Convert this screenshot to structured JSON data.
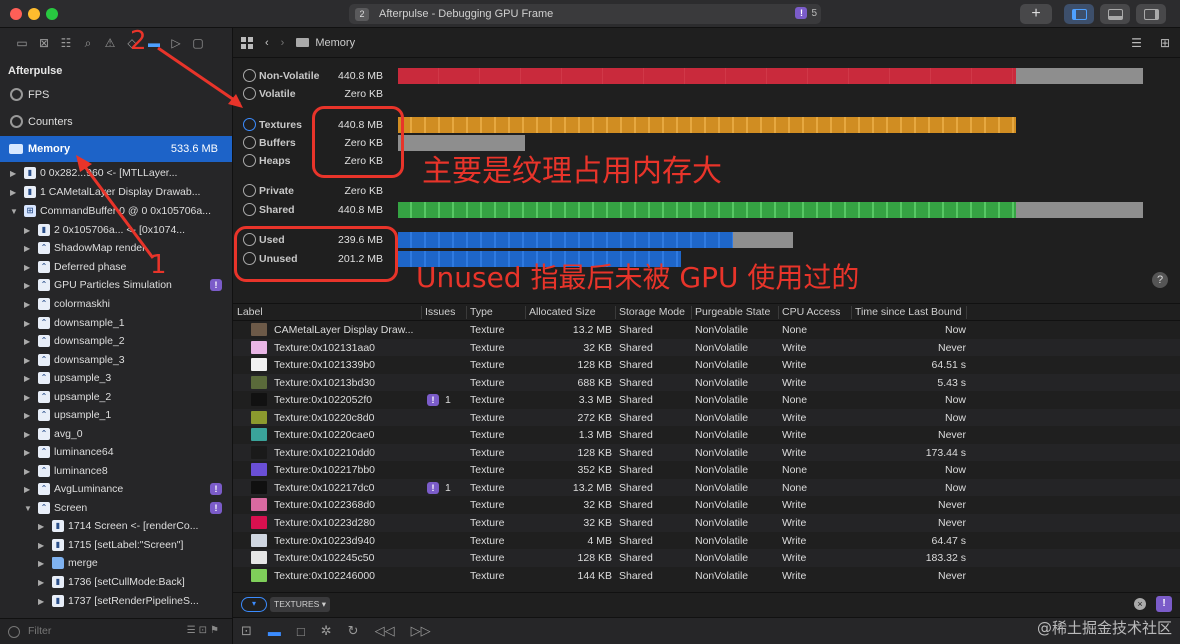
{
  "window": {
    "title": "Afterpulse - Debugging GPU Frame",
    "tab_number": "2",
    "issue_count": "5",
    "issue_mark": "!",
    "plus_label": "+"
  },
  "sidebar": {
    "nav_icons": [
      "folder-icon",
      "x-box-icon",
      "hierarchy-icon",
      "search-icon",
      "warning-icon",
      "diamond-icon",
      "list-icon",
      "tag-icon",
      "comment-icon"
    ],
    "group": "Afterpulse",
    "items": [
      {
        "label": "FPS"
      },
      {
        "label": "Counters"
      },
      {
        "label": "Memory",
        "size": "533.6 MB"
      },
      {
        "label": "0 0x282...960 <- [MTLLayer..."
      },
      {
        "label": "1 CAMetalLayer Display Drawab..."
      },
      {
        "label": "CommandBuffer 0 @ 0 0x105706a..."
      },
      {
        "label": "2 0x105706a... <- [0x1074..."
      },
      {
        "label": "ShadowMap render"
      },
      {
        "label": "Deferred phase"
      },
      {
        "label": "GPU Particles Simulation"
      },
      {
        "label": "colormaskhi"
      },
      {
        "label": "downsample_1"
      },
      {
        "label": "downsample_2"
      },
      {
        "label": "downsample_3"
      },
      {
        "label": "upsample_3"
      },
      {
        "label": "upsample_2"
      },
      {
        "label": "upsample_1"
      },
      {
        "label": "avg_0"
      },
      {
        "label": "luminance64"
      },
      {
        "label": "luminance8"
      },
      {
        "label": "AvgLuminance"
      },
      {
        "label": "Screen"
      },
      {
        "label": "1714 Screen <- [renderCo..."
      },
      {
        "label": "1715 [setLabel:\"Screen\"]"
      },
      {
        "label": "merge"
      },
      {
        "label": "1736 [setCullMode:Back]"
      },
      {
        "label": "1737 [setRenderPipelineS..."
      }
    ],
    "filter_placeholder": "Filter"
  },
  "main": {
    "breadcrumb": "Memory",
    "memory_rows": [
      {
        "label": "Non-Volatile",
        "value": "440.8 MB",
        "fill": 0.83,
        "total": 1.0,
        "color": "#c92a3c"
      },
      {
        "label": "Volatile",
        "value": "Zero KB",
        "fill": 0,
        "total": 0,
        "color": "#8e8e8e"
      },
      {
        "label": "Textures",
        "value": "440.8 MB",
        "fill": 0.83,
        "total": 0.83,
        "color": "#d08d22"
      },
      {
        "label": "Buffers",
        "value": "Zero KB",
        "fill": 0,
        "total": 0.17,
        "color": "#8e8e8e"
      },
      {
        "label": "Heaps",
        "value": "Zero KB",
        "fill": 0,
        "total": 0,
        "color": "#8e8e8e"
      },
      {
        "label": "Private",
        "value": "Zero KB",
        "fill": 0,
        "total": 0,
        "color": "#8e8e8e"
      },
      {
        "label": "Shared",
        "value": "440.8 MB",
        "fill": 0.83,
        "total": 1.0,
        "color": "#35a343"
      },
      {
        "label": "Used",
        "value": "239.6 MB",
        "fill": 0.45,
        "total": 0.53,
        "color": "#1e66c9"
      },
      {
        "label": "Unused",
        "value": "201.2 MB",
        "fill": 0.38,
        "total": 0.38,
        "color": "#1e66c9"
      }
    ],
    "help_label": "?",
    "table": {
      "columns": [
        "Label",
        "Issues",
        "Type",
        "Allocated Size",
        "Storage Mode",
        "Purgeable State",
        "CPU Access",
        "Time since Last Bound"
      ],
      "rows": [
        {
          "label": "CAMetalLayer Display Draw...",
          "issues": "",
          "type": "Texture",
          "size": "13.2 MB",
          "storage": "Shared",
          "purgeable": "NonVolatile",
          "cpu": "None",
          "time": "Now",
          "thumb": "#6d5a48"
        },
        {
          "label": "Texture:0x102131aa0",
          "issues": "",
          "type": "Texture",
          "size": "32 KB",
          "storage": "Shared",
          "purgeable": "NonVolatile",
          "cpu": "Write",
          "time": "Never",
          "thumb": "#e9b6e6"
        },
        {
          "label": "Texture:0x1021339b0",
          "issues": "",
          "type": "Texture",
          "size": "128 KB",
          "storage": "Shared",
          "purgeable": "NonVolatile",
          "cpu": "Write",
          "time": "64.51 s",
          "thumb": "#f2f2f2"
        },
        {
          "label": "Texture:0x10213bd30",
          "issues": "",
          "type": "Texture",
          "size": "688 KB",
          "storage": "Shared",
          "purgeable": "NonVolatile",
          "cpu": "Write",
          "time": "5.43 s",
          "thumb": "#5a6a3a"
        },
        {
          "label": "Texture:0x1022052f0",
          "issues": "1",
          "type": "Texture",
          "size": "3.3 MB",
          "storage": "Shared",
          "purgeable": "NonVolatile",
          "cpu": "None",
          "time": "Now",
          "thumb": "#111111"
        },
        {
          "label": "Texture:0x10220c8d0",
          "issues": "",
          "type": "Texture",
          "size": "272 KB",
          "storage": "Shared",
          "purgeable": "NonVolatile",
          "cpu": "Write",
          "time": "Now",
          "thumb": "#8c9a2e"
        },
        {
          "label": "Texture:0x10220cae0",
          "issues": "",
          "type": "Texture",
          "size": "1.3 MB",
          "storage": "Shared",
          "purgeable": "NonVolatile",
          "cpu": "Write",
          "time": "Never",
          "thumb": "#3aa39a"
        },
        {
          "label": "Texture:0x102210dd0",
          "issues": "",
          "type": "Texture",
          "size": "128 KB",
          "storage": "Shared",
          "purgeable": "NonVolatile",
          "cpu": "Write",
          "time": "173.44 s",
          "thumb": "#1a1a1a"
        },
        {
          "label": "Texture:0x102217bb0",
          "issues": "",
          "type": "Texture",
          "size": "352 KB",
          "storage": "Shared",
          "purgeable": "NonVolatile",
          "cpu": "None",
          "time": "Now",
          "thumb": "#6a4fd6"
        },
        {
          "label": "Texture:0x102217dc0",
          "issues": "1",
          "type": "Texture",
          "size": "13.2 MB",
          "storage": "Shared",
          "purgeable": "NonVolatile",
          "cpu": "None",
          "time": "Now",
          "thumb": "#101010"
        },
        {
          "label": "Texture:0x1022368d0",
          "issues": "",
          "type": "Texture",
          "size": "32 KB",
          "storage": "Shared",
          "purgeable": "NonVolatile",
          "cpu": "Write",
          "time": "Never",
          "thumb": "#d96aa0"
        },
        {
          "label": "Texture:0x10223d280",
          "issues": "",
          "type": "Texture",
          "size": "32 KB",
          "storage": "Shared",
          "purgeable": "NonVolatile",
          "cpu": "Write",
          "time": "Never",
          "thumb": "#d8104f"
        },
        {
          "label": "Texture:0x10223d940",
          "issues": "",
          "type": "Texture",
          "size": "4 MB",
          "storage": "Shared",
          "purgeable": "NonVolatile",
          "cpu": "Write",
          "time": "64.47 s",
          "thumb": "#cfd6e0"
        },
        {
          "label": "Texture:0x102245c50",
          "issues": "",
          "type": "Texture",
          "size": "128 KB",
          "storage": "Shared",
          "purgeable": "NonVolatile",
          "cpu": "Write",
          "time": "183.32 s",
          "thumb": "#e6e6e6"
        },
        {
          "label": "Texture:0x102246000",
          "issues": "",
          "type": "Texture",
          "size": "144 KB",
          "storage": "Shared",
          "purgeable": "NonVolatile",
          "cpu": "Write",
          "time": "Never",
          "thumb": "#7fcf5a"
        }
      ]
    },
    "filter_token": "TEXTURES",
    "filter_clear": "×"
  },
  "annotations": {
    "num1": "1",
    "num2": "2",
    "textures_note": "主要是纹理占用内存大",
    "unused_note": "Unused 指最后未被 GPU 使用过的"
  },
  "watermark": "@稀土掘金技术社区"
}
